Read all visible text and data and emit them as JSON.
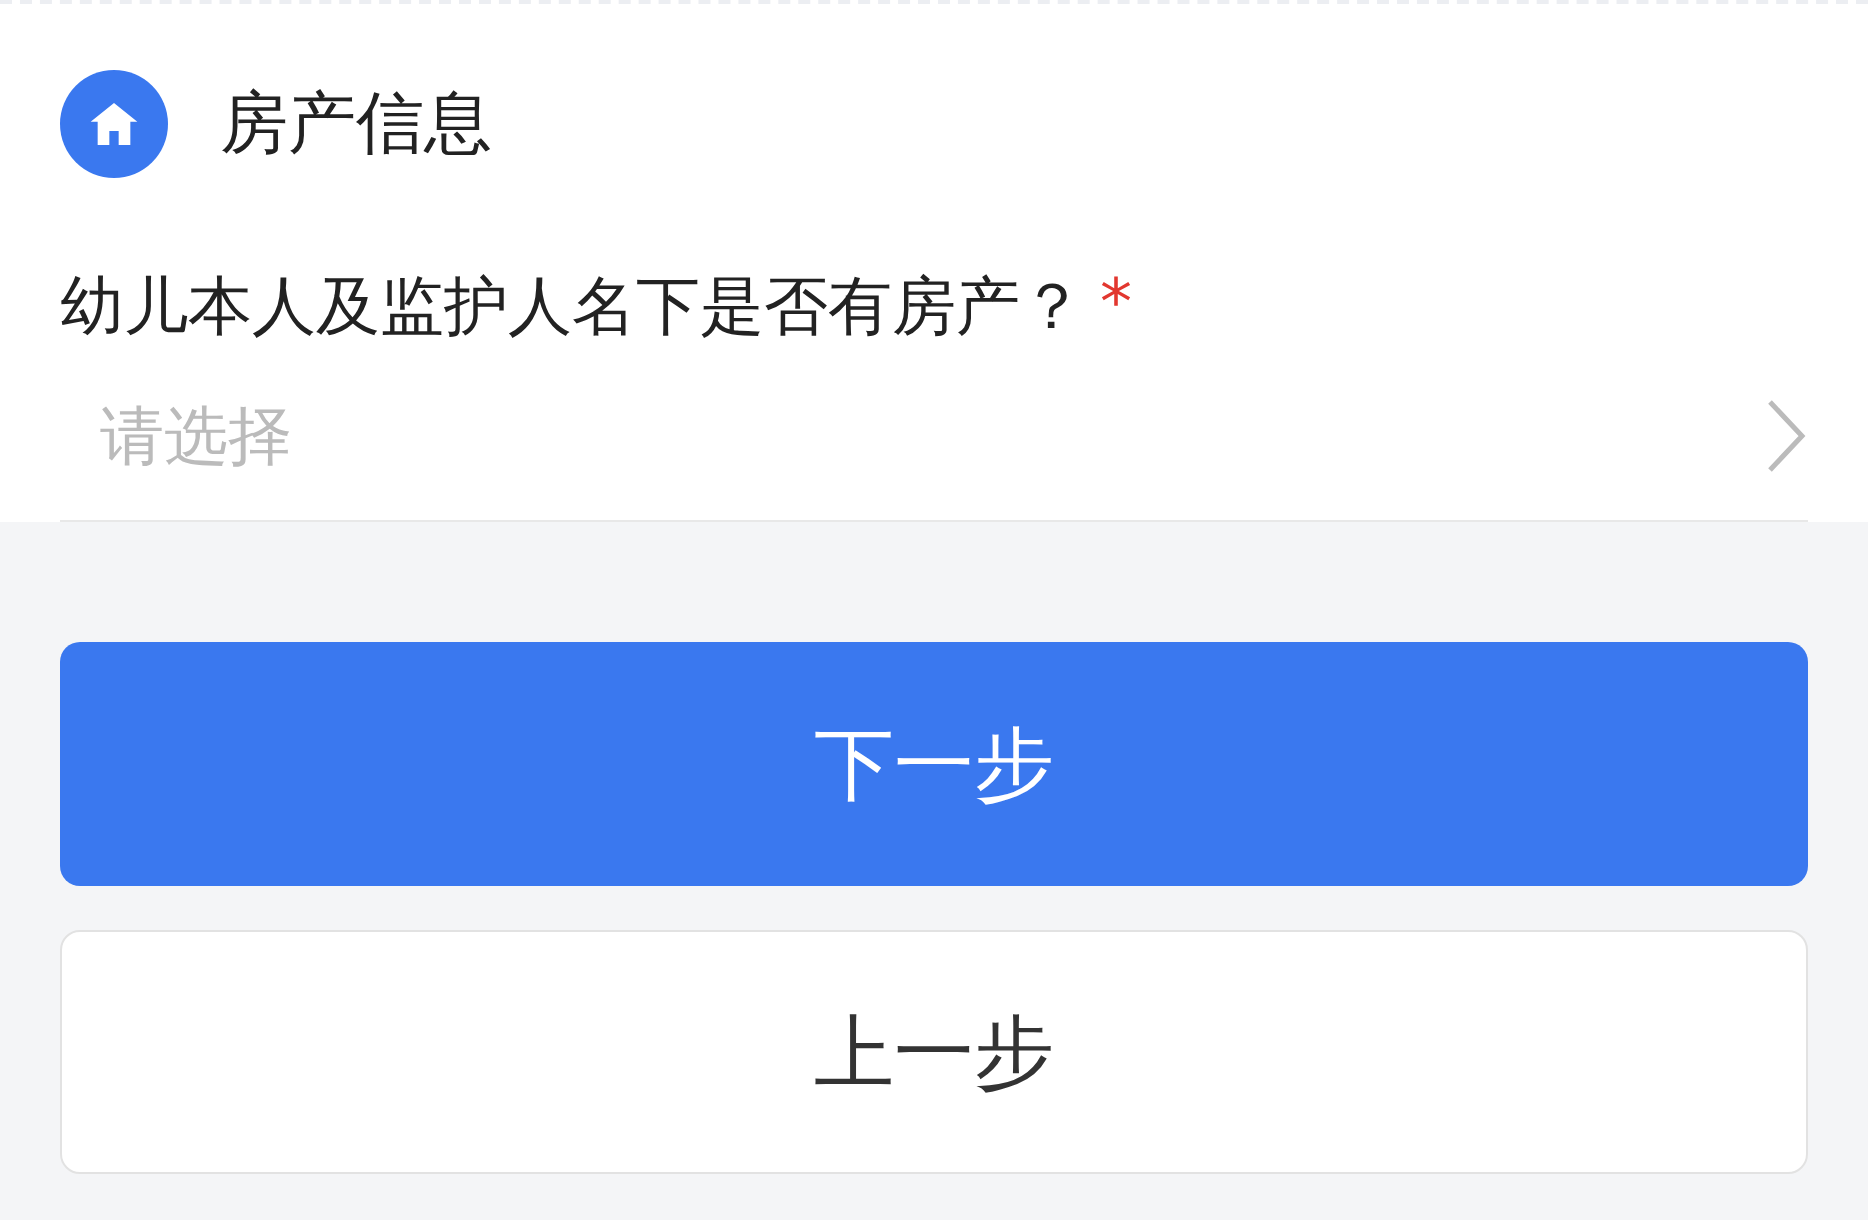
{
  "section": {
    "title": "房产信息"
  },
  "question": {
    "label": "幼儿本人及监护人名下是否有房产？",
    "required_mark": "*",
    "placeholder": "请选择"
  },
  "buttons": [
    {
      "label": "下一步",
      "kind": "primary"
    },
    {
      "label": "上一步",
      "kind": "secondary"
    }
  ]
}
